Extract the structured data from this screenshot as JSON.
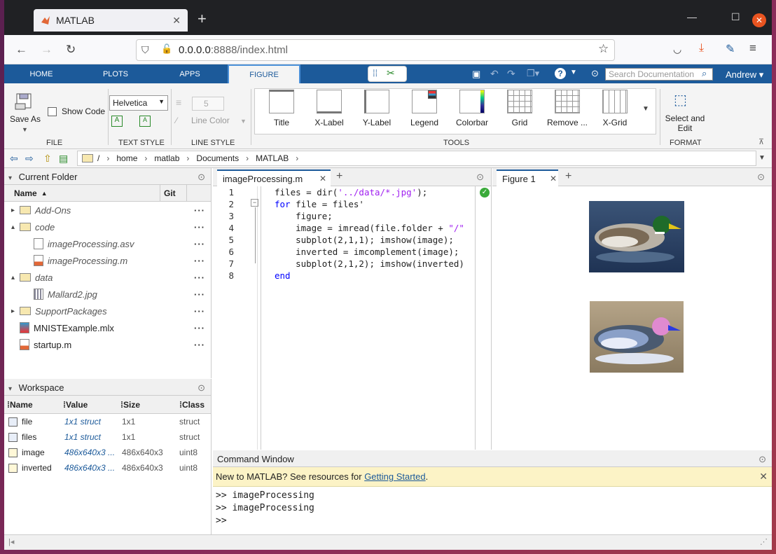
{
  "browser": {
    "tab_title": "MATLAB",
    "url_host": "0.0.0.0",
    "url_rest": ":8888/index.html"
  },
  "ribbon": {
    "tabs": [
      "HOME",
      "PLOTS",
      "APPS",
      "FIGURE"
    ],
    "search_placeholder": "Search Documentation",
    "user": "Andrew",
    "file": {
      "save_as": "Save As",
      "show_code": "Show Code",
      "section": "FILE"
    },
    "text_style": {
      "font": "Helvetica",
      "section": "TEXT STYLE"
    },
    "line_style": {
      "width": "5",
      "line_color": "Line Color",
      "section": "LINE STYLE"
    },
    "tools": [
      "Title",
      "X-Label",
      "Y-Label",
      "Legend",
      "Colorbar",
      "Grid",
      "Remove ...",
      "X-Grid"
    ],
    "tools_section": "TOOLS",
    "format": {
      "select": "Select and",
      "edit": "Edit",
      "section": "FORMAT"
    }
  },
  "address": {
    "root": "/",
    "crumbs": [
      "home",
      "matlab",
      "Documents",
      "MATLAB"
    ]
  },
  "current_folder": {
    "title": "Current Folder",
    "col_name": "Name",
    "col_git": "Git",
    "items": [
      {
        "name": "Add-Ons",
        "type": "folder",
        "indent": 0,
        "arrow": "▸",
        "italic": true
      },
      {
        "name": "code",
        "type": "folder",
        "indent": 0,
        "arrow": "▴",
        "italic": true
      },
      {
        "name": "imageProcessing.asv",
        "type": "file",
        "indent": 1,
        "arrow": "",
        "italic": true
      },
      {
        "name": "imageProcessing.m",
        "type": "m",
        "indent": 1,
        "arrow": "",
        "italic": true
      },
      {
        "name": "data",
        "type": "folder",
        "indent": 0,
        "arrow": "▴",
        "italic": true
      },
      {
        "name": "Mallard2.jpg",
        "type": "img",
        "indent": 1,
        "arrow": "",
        "italic": true
      },
      {
        "name": "SupportPackages",
        "type": "folder",
        "indent": 0,
        "arrow": "▸",
        "italic": true
      },
      {
        "name": "MNISTExample.mlx",
        "type": "mlx",
        "indent": 0,
        "arrow": "",
        "italic": false
      },
      {
        "name": "startup.m",
        "type": "m",
        "indent": 0,
        "arrow": "",
        "italic": false
      }
    ]
  },
  "workspace": {
    "title": "Workspace",
    "cols": [
      "Name",
      "Value",
      "Size",
      "Class"
    ],
    "rows": [
      {
        "name": "file",
        "value": "1x1 struct",
        "size": "1x1",
        "class": "struct"
      },
      {
        "name": "files",
        "value": "1x1 struct",
        "size": "1x1",
        "class": "struct"
      },
      {
        "name": "image",
        "value": "486x640x3 ...",
        "size": "486x640x3",
        "class": "uint8"
      },
      {
        "name": "inverted",
        "value": "486x640x3 ...",
        "size": "486x640x3",
        "class": "uint8"
      }
    ]
  },
  "editor": {
    "tab": "imageProcessing.m",
    "line_numbers": [
      "1",
      "2",
      "3",
      "4",
      "5",
      "6",
      "7",
      "8"
    ]
  },
  "figure": {
    "tab": "Figure 1"
  },
  "command_window": {
    "title": "Command Window",
    "banner_text": "New to MATLAB? See resources for ",
    "banner_link": "Getting Started",
    "banner_end": ".",
    "lines": [
      ">> imageProcessing",
      ">> imageProcessing",
      ">>"
    ]
  }
}
